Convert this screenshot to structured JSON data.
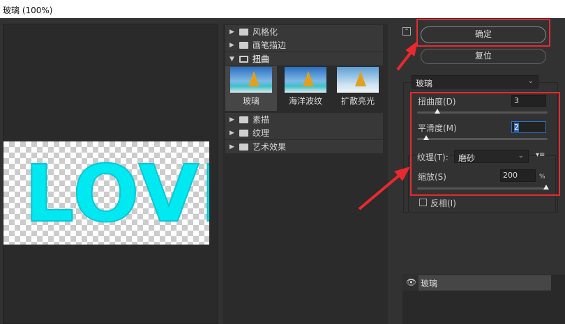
{
  "window": {
    "title": "玻璃 (100%)"
  },
  "preview": {
    "text": "LOVE"
  },
  "filters": {
    "groups": [
      {
        "label": "风格化",
        "expanded": false
      },
      {
        "label": "画笔描边",
        "expanded": false
      },
      {
        "label": "扭曲",
        "expanded": true
      },
      {
        "label": "素描",
        "expanded": false
      },
      {
        "label": "纹理",
        "expanded": false
      },
      {
        "label": "艺术效果",
        "expanded": false
      }
    ],
    "thumbs": [
      {
        "label": "玻璃",
        "selected": true
      },
      {
        "label": "海洋波纹"
      },
      {
        "label": "扩散亮光"
      }
    ]
  },
  "buttons": {
    "ok": "确定",
    "reset": "复位"
  },
  "filter_select": "玻璃",
  "params": {
    "distortion": {
      "label": "扭曲度(D)",
      "value": "3",
      "slider": 0.15
    },
    "smoothness": {
      "label": "平滑度(M)",
      "value": "2",
      "slider": 0.07
    },
    "texture": {
      "label": "纹理(T):",
      "value": "磨砂"
    },
    "scaling": {
      "label": "缩放(S)",
      "value": "200",
      "unit": "%",
      "slider": 1.0
    },
    "invert": {
      "label": "反相(I)",
      "checked": false
    }
  },
  "layers": [
    {
      "label": "玻璃",
      "visible": true
    }
  ],
  "colors": {
    "accent": "#e8292f",
    "text_glow": "#00f0f0"
  }
}
